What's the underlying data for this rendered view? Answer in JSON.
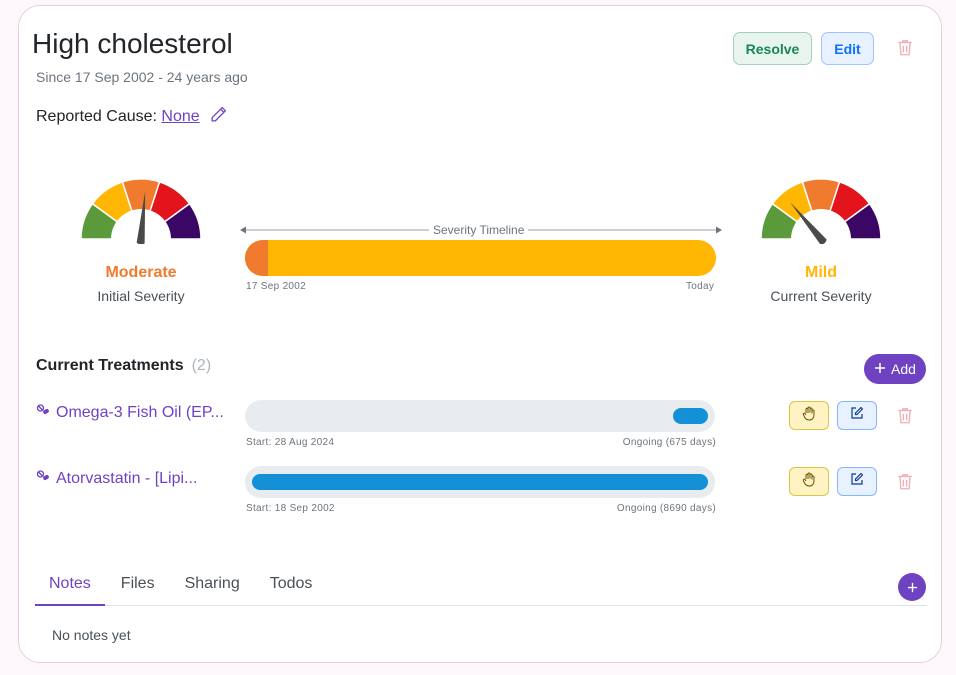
{
  "condition": {
    "title": "High cholesterol",
    "since": "Since 17 Sep 2002 - 24 years ago",
    "cause_label": "Reported Cause:",
    "cause_value": "None"
  },
  "actions": {
    "resolve_label": "Resolve",
    "edit_label": "Edit"
  },
  "severity": {
    "initial": {
      "label": "Moderate",
      "sub": "Initial Severity",
      "color": "#f07b2e",
      "needle_deg": 5
    },
    "current": {
      "label": "Mild",
      "sub": "Current Severity",
      "color": "#ffb703",
      "needle_deg": -40
    },
    "timeline_label": "Severity Timeline",
    "start_date": "17 Sep 2002",
    "end_label": "Today",
    "gauge_colors": [
      "#5b9a3b",
      "#ffb703",
      "#f07b2e",
      "#e3141b",
      "#3b0764"
    ]
  },
  "treatments": {
    "title": "Current Treatments",
    "count": "(2)",
    "add_label": "Add",
    "items": [
      {
        "name": "Omega-3 Fish Oil (EP...",
        "start": "Start: 28 Aug 2024",
        "status": "Ongoing (675 days)",
        "fill_start": 0.91,
        "fill_end": 0.985
      },
      {
        "name": "Atorvastatin - [Lipi...",
        "start": "Start: 18 Sep 2002",
        "status": "Ongoing (8690 days)",
        "fill_start": 0.015,
        "fill_end": 0.985
      }
    ]
  },
  "tabs": [
    {
      "label": "Notes",
      "active": true
    },
    {
      "label": "Files",
      "active": false
    },
    {
      "label": "Sharing",
      "active": false
    },
    {
      "label": "Todos",
      "active": false
    }
  ],
  "notes": {
    "empty_text": "No notes yet"
  },
  "colors": {
    "accent": "#6f42c1",
    "bar_blue": "#1390d6"
  }
}
